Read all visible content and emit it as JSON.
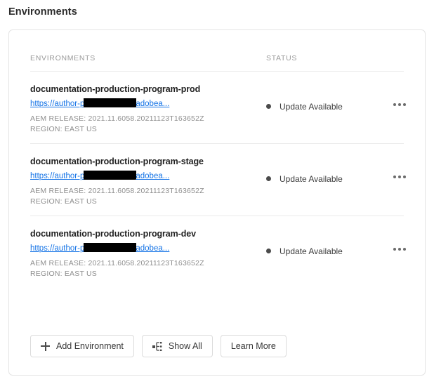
{
  "page": {
    "title": "Environments"
  },
  "table": {
    "columns": {
      "environments": "ENVIRONMENTS",
      "status": "STATUS"
    },
    "rows": [
      {
        "name": "documentation-production-program-prod",
        "url_prefix": "https://author-p",
        "url_suffix": "adobea...",
        "release": "AEM RELEASE: 2021.11.6058.20211123T163652Z",
        "region": "REGION: EAST US",
        "status": "Update Available",
        "status_color": "#4b4b4b"
      },
      {
        "name": "documentation-production-program-stage",
        "url_prefix": "https://author-p",
        "url_suffix": "adobea...",
        "release": "AEM RELEASE: 2021.11.6058.20211123T163652Z",
        "region": "REGION: EAST US",
        "status": "Update Available",
        "status_color": "#4b4b4b"
      },
      {
        "name": "documentation-production-program-dev",
        "url_prefix": "https://author-p",
        "url_suffix": "adobea...",
        "release": "AEM RELEASE: 2021.11.6058.20211123T163652Z",
        "region": "REGION: EAST US",
        "status": "Update Available",
        "status_color": "#4b4b4b"
      }
    ]
  },
  "footer": {
    "add_environment": "Add Environment",
    "show_all": "Show All",
    "learn_more": "Learn More"
  },
  "icons": {
    "add": "plus-icon",
    "show_all": "hierarchy-icon",
    "more": "more-options-icon"
  },
  "colors": {
    "link": "#1473e6",
    "border": "#e4e4e4",
    "divider": "#ebebeb",
    "muted_text": "#8e8e8e",
    "redaction": "#000000"
  }
}
